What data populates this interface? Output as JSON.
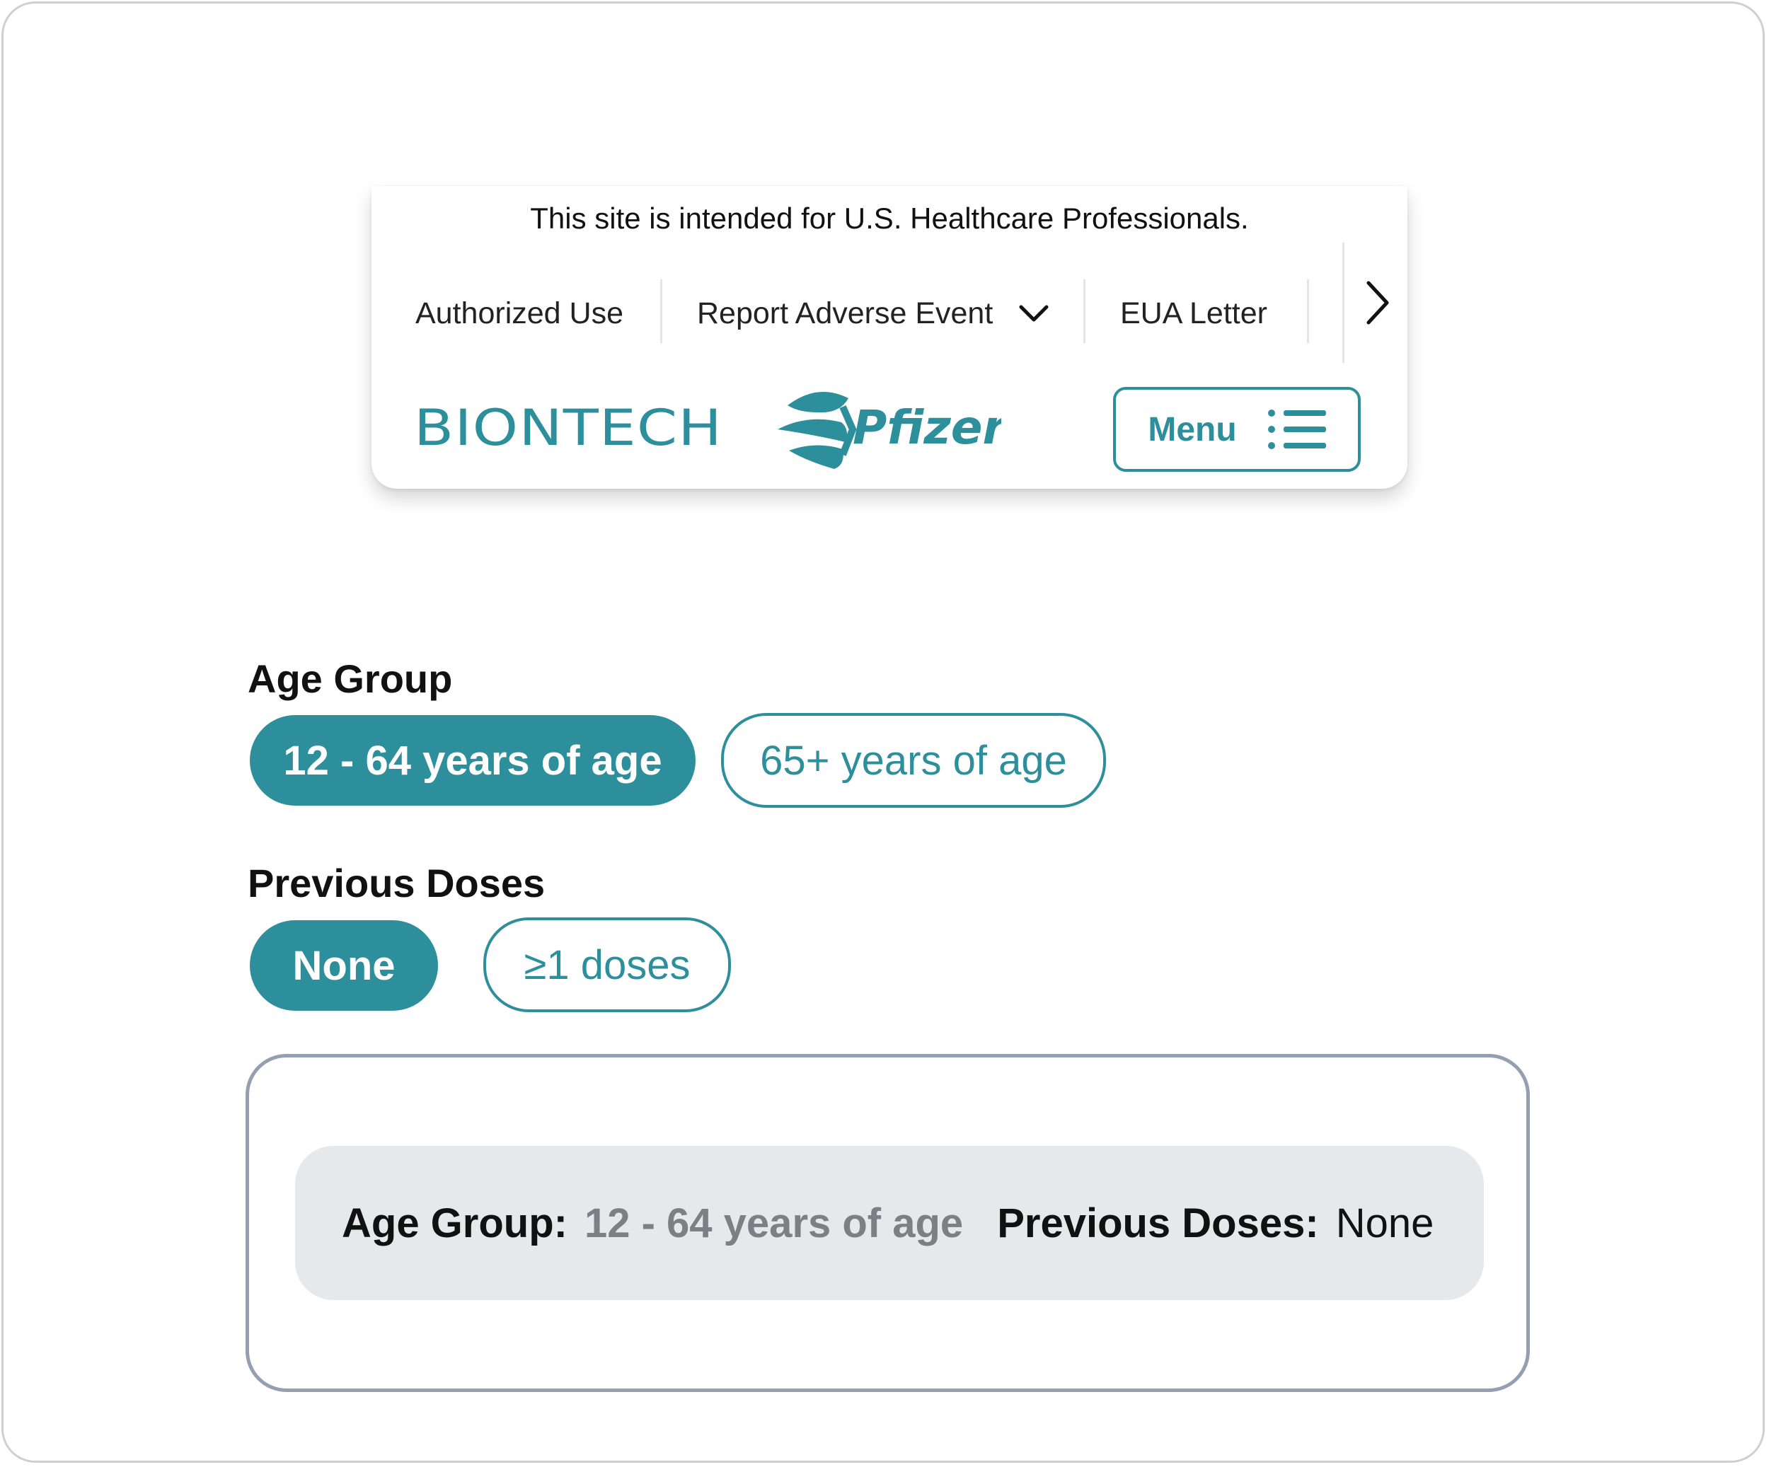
{
  "header": {
    "hcp_notice": "This site is intended for U.S. Healthcare Professionals.",
    "utility_nav": [
      {
        "label": "Authorized Use"
      },
      {
        "label": "Report Adverse Event"
      },
      {
        "label": "EUA Letter"
      }
    ],
    "brands": {
      "biontech": "BIONTECH",
      "pfizer": "Pfizer"
    },
    "menu_label": "Menu"
  },
  "filters": {
    "age_group": {
      "title": "Age Group",
      "options": [
        "12 - 64 years of age",
        "65+ years of age"
      ],
      "selected": "12 - 64 years of age"
    },
    "previous_doses": {
      "title": "Previous Doses",
      "options": [
        "None",
        "≥1 doses"
      ],
      "selected": "None"
    }
  },
  "summary": {
    "age_label": "Age Group:",
    "age_value": "12 - 64 years of age",
    "doses_label": "Previous Doses:",
    "doses_value": "None"
  },
  "colors": {
    "accent": "#2e8f9c",
    "summary_bg": "#e6e8eb",
    "summary_border": "#949fb0"
  },
  "icons": [
    "chevron-down-icon",
    "chevron-right-icon",
    "menu-list-icon",
    "biontech-logo",
    "pfizer-logo"
  ]
}
